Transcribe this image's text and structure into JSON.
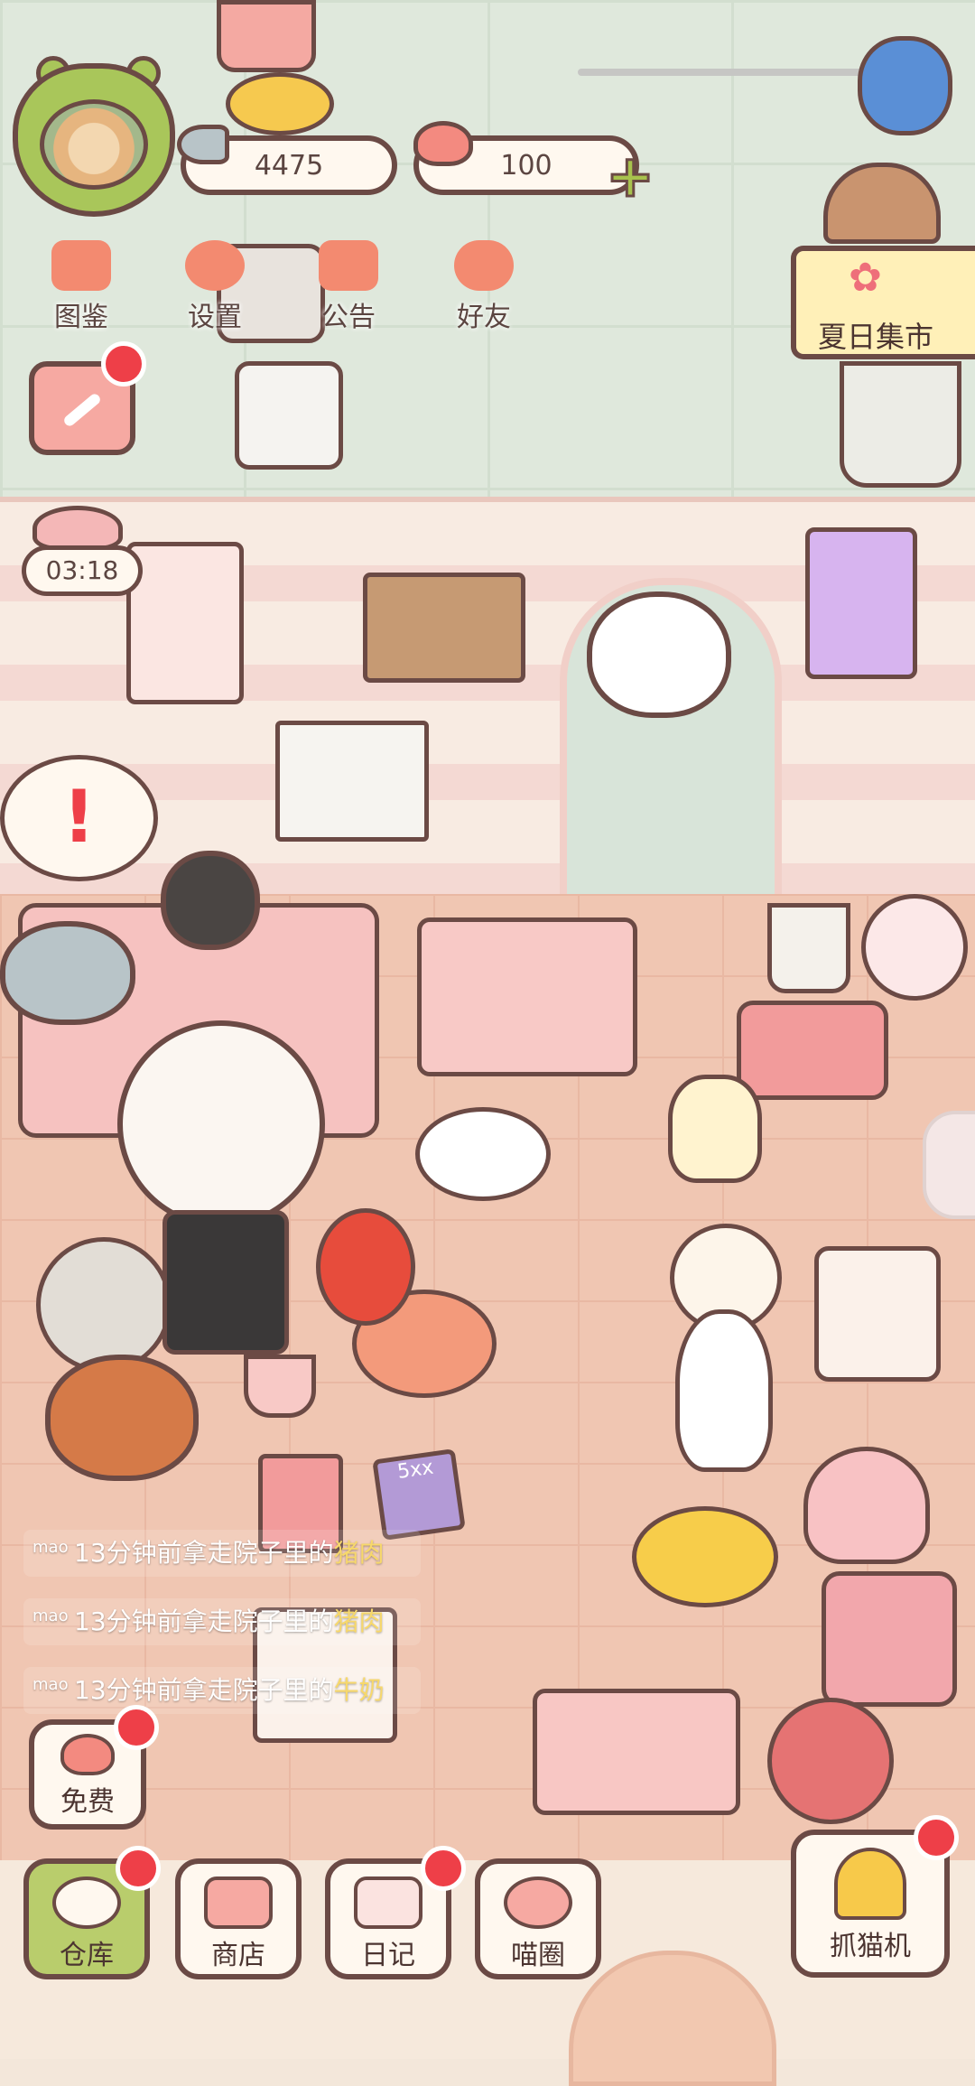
{
  "currency": {
    "coins": "4475",
    "hearts": "100"
  },
  "top_menu": [
    {
      "label": "图鉴",
      "icon": "cat-book-icon"
    },
    {
      "label": "设置",
      "icon": "gear-icon"
    },
    {
      "label": "公告",
      "icon": "gift-icon"
    },
    {
      "label": "好友",
      "icon": "friends-icon"
    }
  ],
  "timer": "03:18",
  "event_banner": {
    "label": "夏日集市"
  },
  "notices": [
    {
      "user": "mao",
      "text": "13分钟前拿走院子里的",
      "object": "猪肉"
    },
    {
      "user": "mao",
      "text": "13分钟前拿走院子里的",
      "object": "猪肉"
    },
    {
      "user": "mao",
      "text": "13分钟前拿走院子里的",
      "object": "牛奶"
    }
  ],
  "free_button": {
    "label": "免费"
  },
  "bottom_nav": [
    {
      "label": "仓库",
      "icon": "storage-box-icon",
      "badge": true,
      "active": true
    },
    {
      "label": "商店",
      "icon": "shop-icon",
      "badge": false
    },
    {
      "label": "日记",
      "icon": "diary-icon",
      "badge": true
    },
    {
      "label": "喵圈",
      "icon": "planet-cat-icon",
      "badge": false
    }
  ],
  "claw_machine": {
    "label": "抓猫机"
  },
  "decor": {
    "book_label": "5xx"
  },
  "colors": {
    "accent": "#f38a70",
    "badge": "#ee3f48",
    "frame": "#6b4a45",
    "green": "#a9c65a"
  }
}
